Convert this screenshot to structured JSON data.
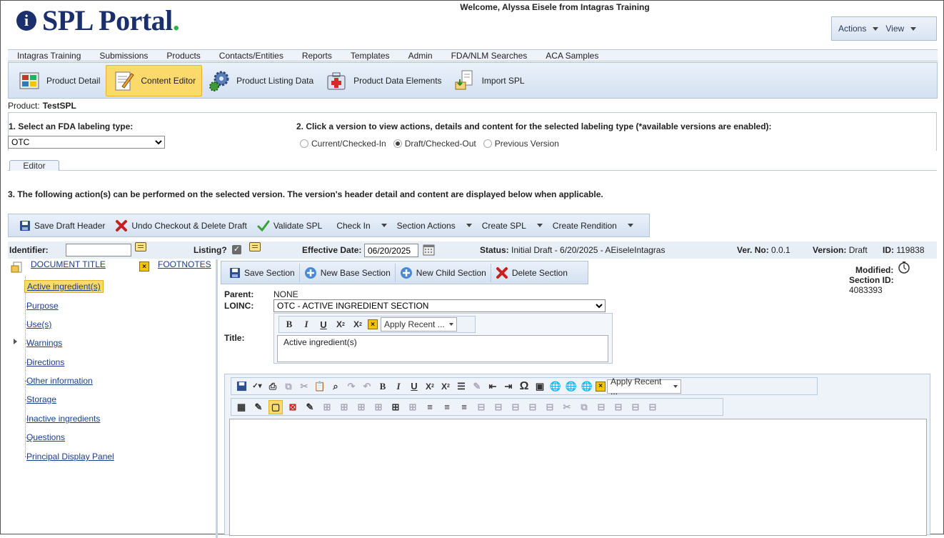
{
  "header": {
    "logo_text": "SPL Portal",
    "logo_dot": ".",
    "logo_icon": "i",
    "welcome": "Welcome, Alyssa Eisele from Intagras Training",
    "actions_label": "Actions",
    "view_label": "View"
  },
  "menu": [
    "Intagras Training",
    "Submissions",
    "Products",
    "Contacts/Entities",
    "Reports",
    "Templates",
    "Admin",
    "FDA/NLM Searches",
    "ACA Samples"
  ],
  "iconbar": [
    {
      "label": "Product Detail",
      "icon": "product-detail-icon"
    },
    {
      "label": "Content Editor",
      "icon": "content-editor-icon",
      "active": true
    },
    {
      "label": "Product Listing Data",
      "icon": "gears-icon"
    },
    {
      "label": "Product Data Elements",
      "icon": "medical-kit-icon"
    },
    {
      "label": "Import SPL",
      "icon": "import-icon"
    }
  ],
  "product": {
    "label": "Product:",
    "name": "TestSPL"
  },
  "step1": {
    "label": "1. Select an FDA labeling type:",
    "selected": "OTC"
  },
  "step2": {
    "label": "2. Click a version to view actions, details and content for the selected labeling type (*available versions are enabled):",
    "options": [
      "Current/Checked-In",
      "Draft/Checked-Out",
      "Previous Version"
    ],
    "selected_index": 1
  },
  "tab": "Editor",
  "step3": "3. The following action(s) can be performed on the selected version. The version's header detail and content are displayed below when applicable.",
  "actions": {
    "save_draft": "Save Draft Header",
    "undo_checkout": "Undo Checkout & Delete Draft",
    "validate": "Validate SPL",
    "check_in": "Check In",
    "section_actions": "Section Actions",
    "create_spl": "Create SPL",
    "create_rendition": "Create Rendition"
  },
  "idbar": {
    "identifier_label": "Identifier:",
    "identifier_value": "",
    "listing_label": "Listing?",
    "effective_label": "Effective Date:",
    "effective_value": "06/20/2025",
    "status_label": "Status:",
    "status_value": "Initial Draft - 6/20/2025 - AEiseleIntagras",
    "verno_label": "Ver. No:",
    "verno_value": "0.0.1",
    "version_label": "Version:",
    "version_value": "Draft",
    "id_label": "ID:",
    "id_value": "119838"
  },
  "tree": {
    "document_title": "DOCUMENT TITLE",
    "footnotes": "FOOTNOTES",
    "items": [
      "Active ingredient(s)",
      "Purpose",
      "Use(s)",
      "Warnings",
      "Directions",
      "Other information",
      "Storage",
      "Inactive ingredients",
      "Questions",
      "Principal Display Panel"
    ],
    "selected_index": 0
  },
  "section": {
    "save": "Save Section",
    "new_base": "New Base Section",
    "new_child": "New Child Section",
    "delete": "Delete Section",
    "parent_label": "Parent:",
    "parent_value": "NONE",
    "loinc_label": "LOINC:",
    "loinc_value": "OTC - ACTIVE INGREDIENT SECTION",
    "title_label": "Title:",
    "title_value": "Active ingredient(s)",
    "apply_recent": "Apply Recent ...",
    "modified_label": "Modified:",
    "section_id_label": "Section ID:",
    "section_id_value": "4083393"
  }
}
